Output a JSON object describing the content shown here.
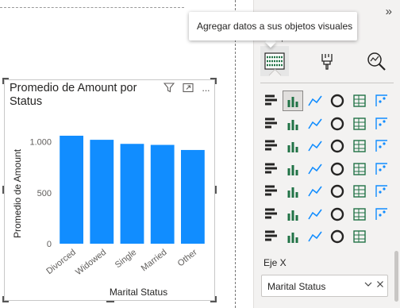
{
  "tooltip": {
    "text": "Agregar datos a sus objetos visuales"
  },
  "pane": {
    "build_label": "Compilar visual",
    "collapse_glyph": "»",
    "section_label": "Eje X",
    "field_well": {
      "value": "Marital Status"
    }
  },
  "visual": {
    "header_icons": [
      "filter-icon",
      "focus-mode-icon",
      "more-options-icon"
    ],
    "more_glyph": "···"
  },
  "colors": {
    "bar": "#118dff",
    "accent": "#118dff",
    "pane_bg": "#f3f2f1"
  },
  "chart_data": {
    "type": "bar",
    "title": "Promedio de Amount por Status",
    "xlabel": "Marital Status",
    "ylabel": "Promedio de Amount",
    "categories": [
      "Divorced",
      "Widowed",
      "Single",
      "Married",
      "Other"
    ],
    "values": [
      1060,
      1020,
      980,
      970,
      920
    ],
    "yticks": [
      "0",
      "500",
      "1.000"
    ],
    "ytick_values": [
      0,
      500,
      1000
    ],
    "ylim": [
      0,
      1200
    ],
    "grid": false,
    "legend": "none"
  }
}
